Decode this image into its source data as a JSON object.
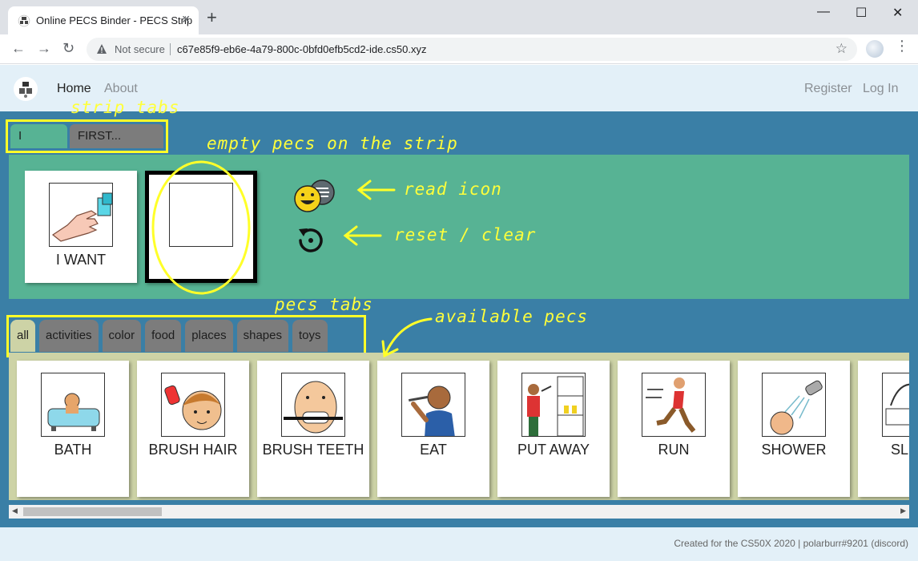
{
  "browser": {
    "tab_title": "Online PECS Binder - PECS Strip",
    "tab_close": "✕",
    "new_tab": "+",
    "window_minimize": "—",
    "window_maximize": "☐",
    "window_close": "✕",
    "back": "←",
    "forward": "→",
    "reload": "↻",
    "security": "Not secure",
    "url": "c67e85f9-eb6e-4a79-800c-0bfd0efb5cd2-ide.cs50.xyz",
    "bookmark": "☆",
    "menu": "⋮"
  },
  "nav": {
    "home": "Home",
    "about": "About",
    "register": "Register",
    "login": "Log In"
  },
  "strip_tabs": [
    "I WANT",
    "FIRST... THEN"
  ],
  "strip": {
    "cards": [
      {
        "label": "I WANT",
        "icon": "hand-reaching-cup-icon"
      },
      {
        "label": "",
        "icon": "empty-slot"
      }
    ],
    "read_icon": "read-aloud-icon",
    "reset_icon": "reset-icon"
  },
  "pecs_tabs": [
    "all",
    "activities",
    "color",
    "food",
    "places",
    "shapes",
    "toys"
  ],
  "available_pecs": [
    {
      "label": "BATH",
      "icon": "bath-icon"
    },
    {
      "label": "BRUSH HAIR",
      "icon": "brush-hair-icon"
    },
    {
      "label": "BRUSH TEETH",
      "icon": "brush-teeth-icon"
    },
    {
      "label": "EAT",
      "icon": "eat-icon"
    },
    {
      "label": "PUT AWAY",
      "icon": "put-away-icon"
    },
    {
      "label": "RUN",
      "icon": "run-icon"
    },
    {
      "label": "SHOWER",
      "icon": "shower-icon"
    },
    {
      "label": "SLEEP",
      "icon": "sleep-icon"
    }
  ],
  "footer": "Created for the CS50X 2020 | polarburr#9201 (discord)",
  "annotations": {
    "strip_tabs": "strip tabs",
    "empty_pecs": "empty pecs on the strip",
    "read_icon": "read icon",
    "reset": "reset / clear",
    "pecs_tabs": "pecs tabs",
    "available": "available pecs"
  },
  "colors": {
    "page_bg": "#3a7fa6",
    "strip_bg": "#57b394",
    "available_bg": "#cdd3a6",
    "inactive_tab": "#7c7c7c",
    "annotation": "#ffff29"
  }
}
